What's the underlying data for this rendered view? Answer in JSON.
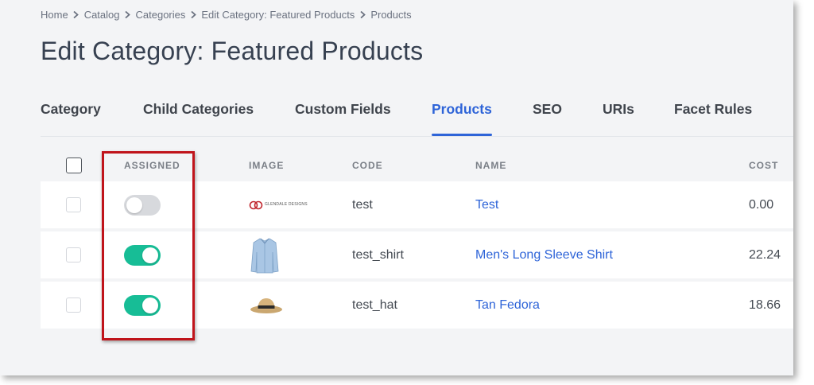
{
  "breadcrumb": [
    "Home",
    "Catalog",
    "Categories",
    "Edit Category: Featured Products",
    "Products"
  ],
  "page_title": "Edit Category: Featured Products",
  "tabs": [
    {
      "label": "Category",
      "active": false
    },
    {
      "label": "Child Categories",
      "active": false
    },
    {
      "label": "Custom Fields",
      "active": false
    },
    {
      "label": "Products",
      "active": true
    },
    {
      "label": "SEO",
      "active": false
    },
    {
      "label": "URIs",
      "active": false
    },
    {
      "label": "Facet Rules",
      "active": false
    }
  ],
  "table": {
    "columns": {
      "assigned": "ASSIGNED",
      "image": "IMAGE",
      "code": "CODE",
      "name": "NAME",
      "cost": "COST"
    },
    "rows": [
      {
        "selected": false,
        "assigned": false,
        "image": "glendale-designs-logo",
        "image_text": "GLENDALE DESIGNS",
        "code": "test",
        "name": "Test",
        "cost": "0.00"
      },
      {
        "selected": false,
        "assigned": true,
        "image": "shirt-image",
        "code": "test_shirt",
        "name": "Men's Long Sleeve Shirt",
        "cost": "22.24"
      },
      {
        "selected": false,
        "assigned": true,
        "image": "fedora-hat-image",
        "code": "test_hat",
        "name": "Tan Fedora",
        "cost": "18.66"
      }
    ]
  },
  "colors": {
    "accent": "#2e64d8",
    "toggle_on": "#17bd96",
    "toggle_off": "#d7d9dd",
    "highlight": "#c0141b"
  }
}
